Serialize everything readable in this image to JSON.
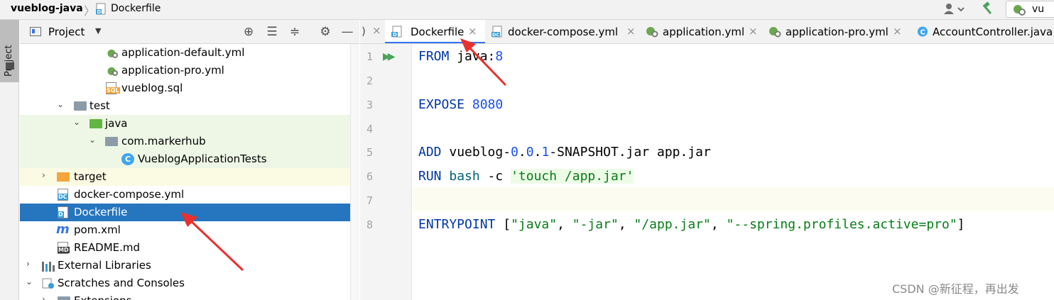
{
  "breadcrumb": {
    "root": "vueblog-java",
    "file": "Dockerfile"
  },
  "toolbar": {
    "run_config_label": "vu"
  },
  "tool_window": {
    "strip_label": "Project"
  },
  "project_panel": {
    "title": "Project",
    "tree": [
      {
        "label": "application-default.yml",
        "icon": "yml-icon",
        "depth": 5
      },
      {
        "label": "application-pro.yml",
        "icon": "yml-icon",
        "depth": 5
      },
      {
        "label": "vueblog.sql",
        "icon": "sql-file-icon",
        "depth": 5
      },
      {
        "label": "test",
        "icon": "folder-icon",
        "depth": 3
      },
      {
        "label": "java",
        "icon": "source-folder-icon",
        "depth": 4
      },
      {
        "label": "com.markerhub",
        "icon": "package-icon",
        "depth": 5
      },
      {
        "label": "VueblogApplicationTests",
        "icon": "test-class-icon",
        "depth": 6
      },
      {
        "label": "target",
        "icon": "excluded-folder-icon",
        "depth": 2
      },
      {
        "label": "docker-compose.yml",
        "icon": "docker-compose-icon",
        "depth": 2
      },
      {
        "label": "Dockerfile",
        "icon": "dockerfile-icon",
        "depth": 2
      },
      {
        "label": "pom.xml",
        "icon": "maven-icon",
        "depth": 2
      },
      {
        "label": "README.md",
        "icon": "markdown-icon",
        "depth": 2
      },
      {
        "label": "External Libraries",
        "icon": "libraries-icon",
        "depth": 1
      },
      {
        "label": "Scratches and Consoles",
        "icon": "scratches-icon",
        "depth": 1
      },
      {
        "label": "Extensions",
        "icon": "folder-icon",
        "depth": 2
      }
    ]
  },
  "tabs": {
    "left_fragment": ")",
    "items": [
      {
        "label": "Dockerfile",
        "icon": "dockerfile-icon",
        "active": true
      },
      {
        "label": "docker-compose.yml",
        "icon": "docker-compose-icon",
        "active": false
      },
      {
        "label": "application.yml",
        "icon": "yml-icon",
        "active": false
      },
      {
        "label": "application-pro.yml",
        "icon": "yml-icon",
        "active": false
      },
      {
        "label": "AccountController.java",
        "icon": "class-icon",
        "active": false
      }
    ]
  },
  "editor": {
    "line_numbers": [
      "1",
      "2",
      "3",
      "4",
      "5",
      "6",
      "7",
      "8"
    ],
    "lines": {
      "l1_kw": "FROM",
      "l1_rest": " java:",
      "l1_num": "8",
      "l3_kw": "EXPOSE",
      "l3_num": " 8080",
      "l5_kw": "ADD",
      "l5_a": " vueblog-",
      "l5_n1": "0",
      "l5_d1": ".",
      "l5_n2": "0",
      "l5_d2": ".",
      "l5_n3": "1",
      "l5_b": "-SNAPSHOT.jar app.jar",
      "l6_kw": "RUN",
      "l6_bash": " bash",
      "l6_flag": " -c ",
      "l6_str": "'touch /app.jar'",
      "l8_kw": "ENTRYPOINT",
      "l8_open": " [",
      "l8_s1": "\"java\"",
      "l8_c1": ", ",
      "l8_s2": "\"-jar\"",
      "l8_c2": ", ",
      "l8_s3": "\"/app.jar\"",
      "l8_c3": ", ",
      "l8_s4": "\"--spring.profiles.active=pro\"",
      "l8_close": "]"
    }
  },
  "watermark": "CSDN @新征程，再出发",
  "colors": {
    "selection": "#2675bf",
    "keyword": "#0037a6",
    "number": "#1750eb",
    "string": "#067d17",
    "arrow": "#e8312f"
  }
}
